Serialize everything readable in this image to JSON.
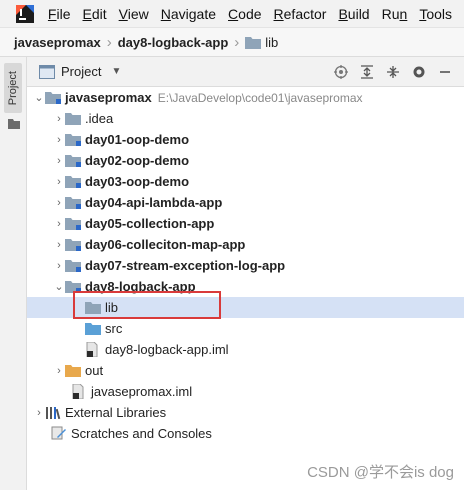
{
  "menubar": {
    "items": [
      {
        "mn": "F",
        "rest": "ile"
      },
      {
        "mn": "E",
        "rest": "dit"
      },
      {
        "mn": "V",
        "rest": "iew"
      },
      {
        "mn": "N",
        "rest": "avigate"
      },
      {
        "mn": "C",
        "rest": "ode"
      },
      {
        "mn": "R",
        "rest": "efactor"
      },
      {
        "mn": "B",
        "rest": "uild"
      },
      {
        "mn": "R",
        "rest": "u",
        "tail": "n"
      },
      {
        "mn": "T",
        "rest": "ools"
      }
    ]
  },
  "breadcrumb": {
    "items": [
      "javasepromax",
      "day8-logback-app",
      "lib"
    ]
  },
  "side_strip": {
    "tab_label": "Project"
  },
  "project_panel": {
    "title": "Project",
    "actions": [
      "locate-icon",
      "expand-all-icon",
      "collapse-all-icon",
      "gear-icon",
      "hide-icon"
    ]
  },
  "tree": {
    "root": {
      "label": "javasepromax",
      "path": "E:\\JavaDevelop\\code01\\javasepromax"
    },
    "idea": ".idea",
    "modules": [
      "day01-oop-demo",
      "day02-oop-demo",
      "day03-oop-demo",
      "day04-api-lambda-app",
      "day05-collection-app",
      "day06-colleciton-map-app",
      "day07-stream-exception-log-app",
      "day8-logback-app"
    ],
    "lib": "lib",
    "src": "src",
    "iml": "day8-logback-app.iml",
    "out": "out",
    "root_iml": "javasepromax.iml",
    "external": "External Libraries",
    "scratches": "Scratches and Consoles"
  },
  "watermark": "CSDN @学不会is dog",
  "colors": {
    "folder": "#8fa4b8",
    "folder_blue": "#5aa0d6",
    "folder_orange": "#e8a84c",
    "selection": "#d5e1f5",
    "highlight": "#d93a3a"
  }
}
